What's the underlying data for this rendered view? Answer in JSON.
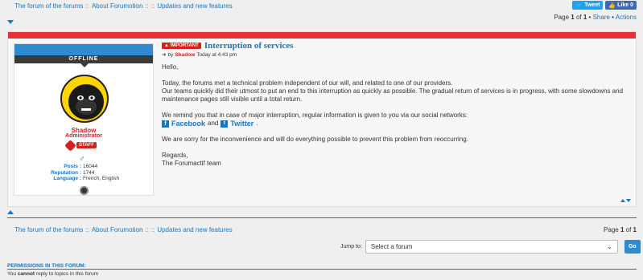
{
  "breadcrumb": {
    "items": [
      "The forum of the forums",
      "About Forumotion",
      "Updates and new features"
    ],
    "seps": [
      "::",
      "::",
      "::"
    ]
  },
  "social": {
    "tweet": "Tweet",
    "like": "Like 0"
  },
  "pagination": {
    "prefix": "Page",
    "current": "1",
    "of": "of",
    "total": "1",
    "share": "Share",
    "actions": "Actions"
  },
  "profile": {
    "status": "OFFLINE",
    "username": "Shadow",
    "rank": "Administrator",
    "staff": "STAFF",
    "gender_icon": "male-icon",
    "stats": [
      {
        "key": "Posts",
        "value": "16044"
      },
      {
        "key": "Reputation",
        "value": "1744"
      },
      {
        "key": "Language",
        "value": "French, English"
      }
    ]
  },
  "post": {
    "badge": "IMPORTANT",
    "title": "Interruption of services",
    "meta_by": "by",
    "author": "Shadow",
    "time": "Today at 4:43 pm",
    "greeting": "Hello,",
    "p1": "Today, the forums met a technical problem independent of our will, and related to one of our providers.",
    "p2": "Our teams quickly did their utmost to put an end to this interruption as quickly as possible. The gradual return of services is in progress, with some slowdowns and maintenance pages still visible until a total return.",
    "p3": "We remind you that in case of major interruption, regular information is given to you via our social networks:",
    "facebook": "Facebook",
    "and": "and",
    "twitter": "Twitter",
    "period": ".",
    "p4": "We are sorry for the inconvenience and will do everything possible to prevent this problem from reoccurring.",
    "regards": "Regards,",
    "signature": "The Forumactif team"
  },
  "bottom_pagination": {
    "prefix": "Page",
    "current": "1",
    "of": "of",
    "total": "1"
  },
  "jump": {
    "label": "Jump to:",
    "placeholder": "Select a forum",
    "go": "Go"
  },
  "permissions": {
    "title": "PERMISSIONS IN THIS FORUM:",
    "you": "You",
    "cannot": "cannot",
    "rest": "reply to topics in this forum"
  },
  "colors": {
    "accent": "#1b75bb",
    "red": "#e8303a",
    "staff": "#d62020"
  }
}
